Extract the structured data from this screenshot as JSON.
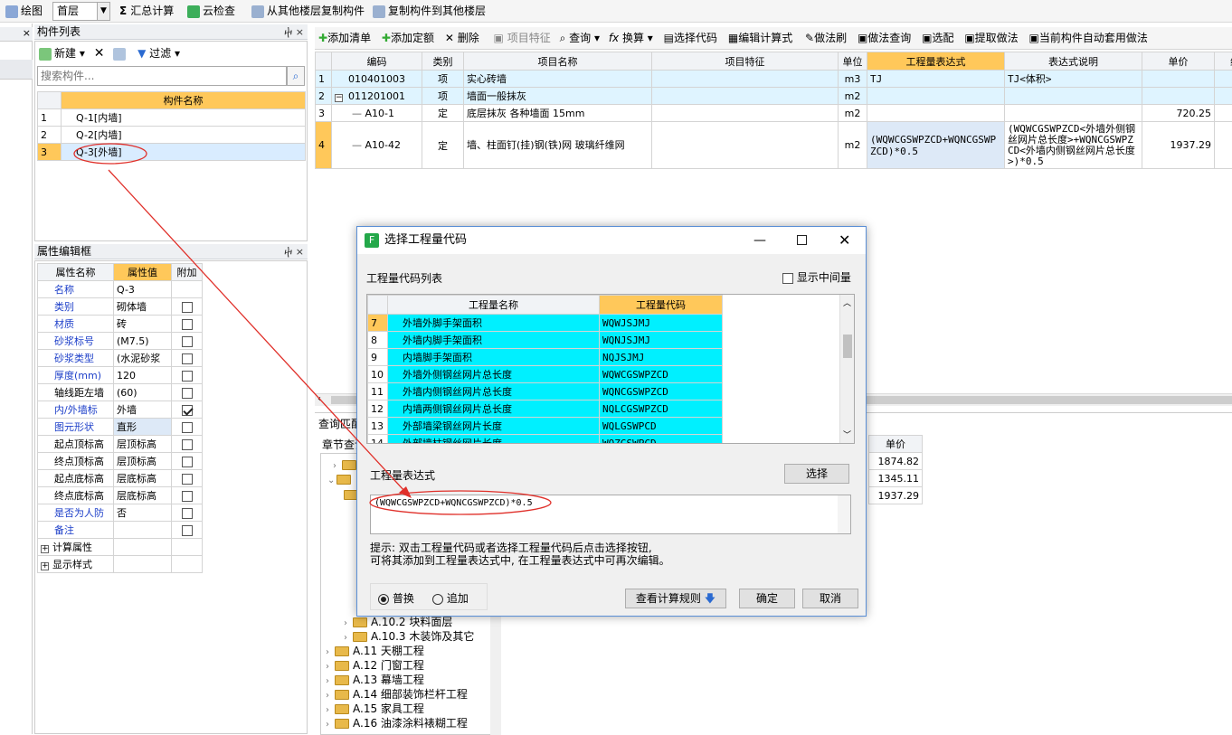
{
  "toolbar": {
    "draw": "绘图",
    "floor": "首层",
    "sum": "汇总计算",
    "cloud": "云检查",
    "copy_from": "从其他楼层复制构件",
    "copy_to": "复制构件到其他楼层"
  },
  "toolbar2": {
    "add_list": "添加清单",
    "add_quota": "添加定额",
    "delete": "删除",
    "item_feature": "项目特征",
    "query": "查询",
    "convert": "换算",
    "select_code": "选择代码",
    "edit_formula": "编辑计算式",
    "method_brush": "做法刷",
    "method_query": "做法查询",
    "match": "选配",
    "extract": "提取做法",
    "auto_apply": "当前构件自动套用做法"
  },
  "component_list": {
    "title": "构件列表",
    "new": "新建",
    "filter": "过滤",
    "search_placeholder": "搜索构件...",
    "col": "构件名称",
    "rows": [
      {
        "n": "1",
        "name": "Q-1[内墙]"
      },
      {
        "n": "2",
        "name": "Q-2[内墙]"
      },
      {
        "n": "3",
        "name": "Q-3[外墙]"
      }
    ]
  },
  "props": {
    "title": "属性编辑框",
    "headers": [
      "属性名称",
      "属性值",
      "附加"
    ],
    "rows": [
      {
        "name": "名称",
        "val": "Q-3",
        "blue": true,
        "chk": false,
        "box": false
      },
      {
        "name": "类别",
        "val": "砌体墙",
        "blue": true,
        "chk": false,
        "box": true
      },
      {
        "name": "材质",
        "val": "砖",
        "blue": true,
        "chk": false,
        "box": true
      },
      {
        "name": "砂浆标号",
        "val": "(M7.5)",
        "blue": true,
        "chk": false,
        "box": true
      },
      {
        "name": "砂浆类型",
        "val": "(水泥砂浆",
        "blue": true,
        "chk": false,
        "box": true
      },
      {
        "name": "厚度(mm)",
        "val": "120",
        "blue": true,
        "chk": false,
        "box": true
      },
      {
        "name": "轴线距左墙",
        "val": "(60)",
        "blue": false,
        "chk": false,
        "box": true
      },
      {
        "name": "内/外墙标",
        "val": "外墙",
        "blue": true,
        "chk": true,
        "box": true
      },
      {
        "name": "图元形状",
        "val": "直形",
        "blue": true,
        "chk": false,
        "box": true
      },
      {
        "name": "起点顶标高",
        "val": "层顶标高",
        "blue": false,
        "chk": false,
        "box": true
      },
      {
        "name": "终点顶标高",
        "val": "层顶标高",
        "blue": false,
        "chk": false,
        "box": true
      },
      {
        "name": "起点底标高",
        "val": "层底标高",
        "blue": false,
        "chk": false,
        "box": true
      },
      {
        "name": "终点底标高",
        "val": "层底标高",
        "blue": false,
        "chk": false,
        "box": true
      },
      {
        "name": "是否为人防",
        "val": "否",
        "blue": true,
        "chk": false,
        "box": true
      },
      {
        "name": "备注",
        "val": "",
        "blue": true,
        "chk": false,
        "box": true
      }
    ],
    "calc": "计算属性",
    "display": "显示样式"
  },
  "main_table": {
    "headers": [
      "编码",
      "类别",
      "项目名称",
      "项目特征",
      "单位",
      "工程量表达式",
      "表达式说明",
      "单价",
      "综"
    ],
    "rows": [
      {
        "n": "1",
        "code": "010401003",
        "type": "项",
        "name": "实心砖墙",
        "feature": "",
        "unit": "m3",
        "expr": "TJ",
        "desc": "TJ<体积>",
        "price": ""
      },
      {
        "n": "2",
        "code": "011201001",
        "type": "项",
        "name": "墙面一般抹灰",
        "feature": "",
        "unit": "m2",
        "expr": "",
        "desc": "",
        "price": ""
      },
      {
        "n": "3",
        "code": "A10-1",
        "type": "定",
        "name": "底层抹灰 各种墙面 15mm",
        "feature": "",
        "unit": "m2",
        "expr": "",
        "desc": "",
        "price": "720.25"
      },
      {
        "n": "4",
        "code": "A10-42",
        "type": "定",
        "name": "墙、柱面钉(挂)钢(铁)网 玻璃纤维网",
        "feature": "",
        "unit": "m2",
        "expr": "(WQWCGSWPZCD+WQNCGSWPZCD)*0.5",
        "desc": "(WQWCGSWPZCD<外墙外侧钢丝网片总长度>+WQNCGSWPZCD<外墙内侧钢丝网片总长度>)*0.5",
        "price": "1937.29"
      }
    ]
  },
  "lower": {
    "tab1": "查询匹配",
    "tab2": "章节查询",
    "price_col": "单价",
    "prices": [
      "1874.82",
      "1345.11",
      "1937.29"
    ],
    "tree": [
      "A.10.2 块料面层",
      "A.10.3 木装饰及其它",
      "A.11 天棚工程",
      "A.12 门窗工程",
      "A.13 幕墙工程",
      "A.14 细部装饰栏杆工程",
      "A.15 家具工程",
      "A.16 油漆涂料裱糊工程"
    ]
  },
  "dialog": {
    "title": "选择工程量代码",
    "list_label": "工程量代码列表",
    "show_mid": "显示中间量",
    "col_name": "工程量名称",
    "col_code": "工程量代码",
    "rows": [
      {
        "n": "7",
        "name": "外墙外脚手架面积",
        "code": "WQWJSJMJ"
      },
      {
        "n": "8",
        "name": "外墙内脚手架面积",
        "code": "WQNJSJMJ"
      },
      {
        "n": "9",
        "name": "内墙脚手架面积",
        "code": "NQJSJMJ"
      },
      {
        "n": "10",
        "name": "外墙外侧钢丝网片总长度",
        "code": "WQWCGSWPZCD"
      },
      {
        "n": "11",
        "name": "外墙内侧钢丝网片总长度",
        "code": "WQNCGSWPZCD"
      },
      {
        "n": "12",
        "name": "内墙两侧钢丝网片总长度",
        "code": "NQLCGSWPZCD"
      },
      {
        "n": "13",
        "name": "外部墙梁钢丝网片长度",
        "code": "WQLGSWPCD"
      },
      {
        "n": "14",
        "name": "外部墙柱钢丝网片长度",
        "code": "WQZGSWPCD"
      }
    ],
    "expr_label": "工程量表达式",
    "select_btn": "选择",
    "expr": "(WQWCGSWPZCD+WQNCGSWPZCD)*0.5",
    "hint1": "提示: 双击工程量代码或者选择工程量代码后点击选择按钮,",
    "hint2": "可将其添加到工程量表达式中, 在工程量表达式中可再次编辑。",
    "replace": "普换",
    "append": "追加",
    "view_rules": "查看计算规则",
    "ok": "确定",
    "cancel": "取消"
  },
  "colors": {
    "accent": "#ffc85a",
    "cyan": "#00f0ff",
    "annot": "#e0302a"
  }
}
